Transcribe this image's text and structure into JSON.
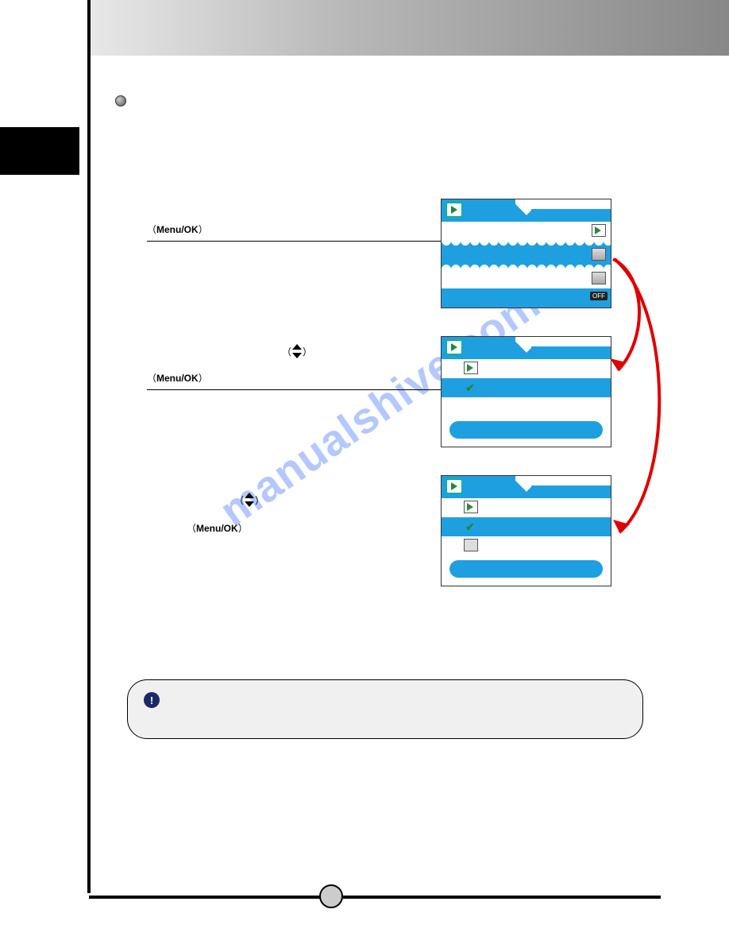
{
  "watermark": "manualshive.com",
  "bullet_label": "Menu/OK",
  "steps": [
    {
      "menu_label": "Menu/OK"
    },
    {
      "menu_label": "Menu/OK"
    },
    {
      "menu_label": "Menu/OK"
    }
  ],
  "note": {
    "icon": "!"
  },
  "screens": {
    "s1": {
      "off_label": "OFF"
    }
  },
  "colors": {
    "accent": "#1ea0e0",
    "arrow": "#e00000"
  }
}
